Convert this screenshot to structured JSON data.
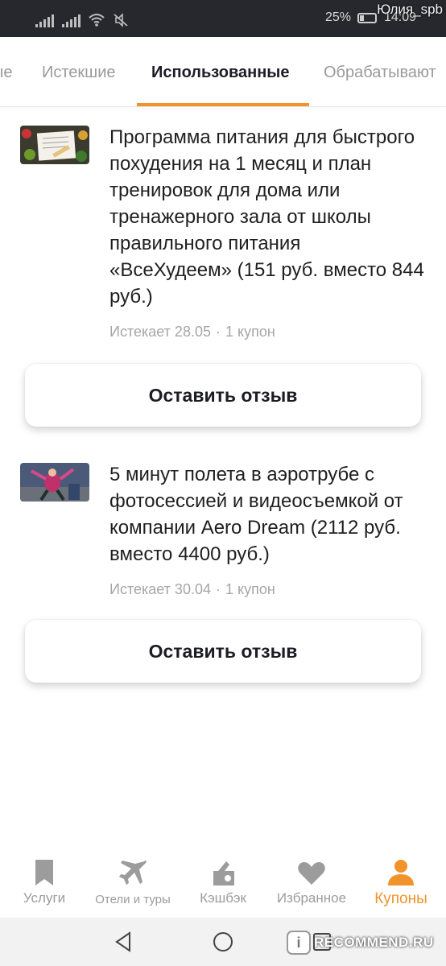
{
  "status_bar": {
    "battery_percent": "25%",
    "time": "14:09",
    "watermark_user": "Юлия_spb"
  },
  "tabs": [
    {
      "label": "ые"
    },
    {
      "label": "Истекшие"
    },
    {
      "label": "Использованные",
      "active": true
    },
    {
      "label": "Обрабатывают"
    }
  ],
  "coupons": [
    {
      "title": "Программа питания для быстрого похудения на 1 месяц и план тренировок для дома или тренажерного зала от школы правильного питания «ВсеХудеем» (151 руб. вместо 844 руб.)",
      "expires": "Истекает 28.05",
      "count": "1 купон",
      "button": "Оставить отзыв",
      "thumb_icon": "food-notebook-image"
    },
    {
      "title": "5 минут полета в аэротрубе с фотосессией и видеосъемкой от компании Aero Dream (2112 руб. вместо 4400 руб.)",
      "expires": "Истекает 30.04",
      "count": "1 купон",
      "button": "Оставить отзыв",
      "thumb_icon": "skydiving-image"
    }
  ],
  "bottom_nav": [
    {
      "label": "Услуги",
      "icon": "bookmark-icon"
    },
    {
      "label": "Отели и туры",
      "icon": "airplane-icon"
    },
    {
      "label": "Кэшбэк",
      "icon": "wallet-icon"
    },
    {
      "label": "Избранное",
      "icon": "heart-icon"
    },
    {
      "label": "Купоны",
      "icon": "person-icon",
      "active": true
    }
  ],
  "watermark": {
    "text": "RECOMMEND.RU",
    "logo": "i"
  },
  "colors": {
    "accent": "#f0932b",
    "inactive": "#9c9c9c",
    "status_bar": "#26282d"
  }
}
